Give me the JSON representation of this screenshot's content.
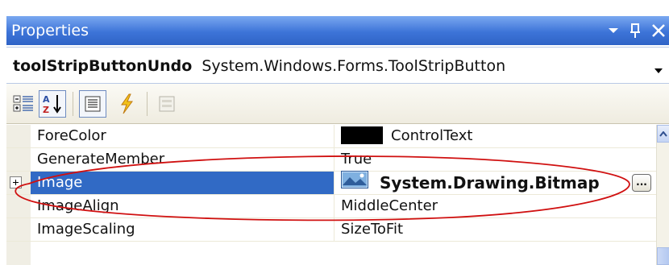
{
  "window": {
    "title": "Properties",
    "controls": [
      "dropdown-icon",
      "pin-icon",
      "close-icon"
    ]
  },
  "object_selector": {
    "name": "toolStripButtonUndo",
    "type": "System.Windows.Forms.ToolStripButton"
  },
  "toolbar": {
    "buttons": [
      "categorized-icon",
      "alphabetical-icon",
      "properties-icon",
      "events-icon",
      "property-pages-icon"
    ],
    "active": "alphabetical-icon"
  },
  "properties": [
    {
      "name": "ForeColor",
      "value": "ControlText",
      "swatch": "#000000"
    },
    {
      "name": "GenerateMember",
      "value": "True"
    },
    {
      "name": "Image",
      "value": "System.Drawing.Bitmap",
      "expandable": true,
      "selected": true,
      "has_ellipsis": true,
      "ellipsis_label": "..."
    },
    {
      "name": "ImageAlign",
      "value": "MiddleCenter"
    },
    {
      "name": "ImageScaling",
      "value": "SizeToFit"
    }
  ],
  "colors": {
    "title_bar": "#3d74d8",
    "selection": "#316ac5",
    "annotation": "#d01010"
  }
}
